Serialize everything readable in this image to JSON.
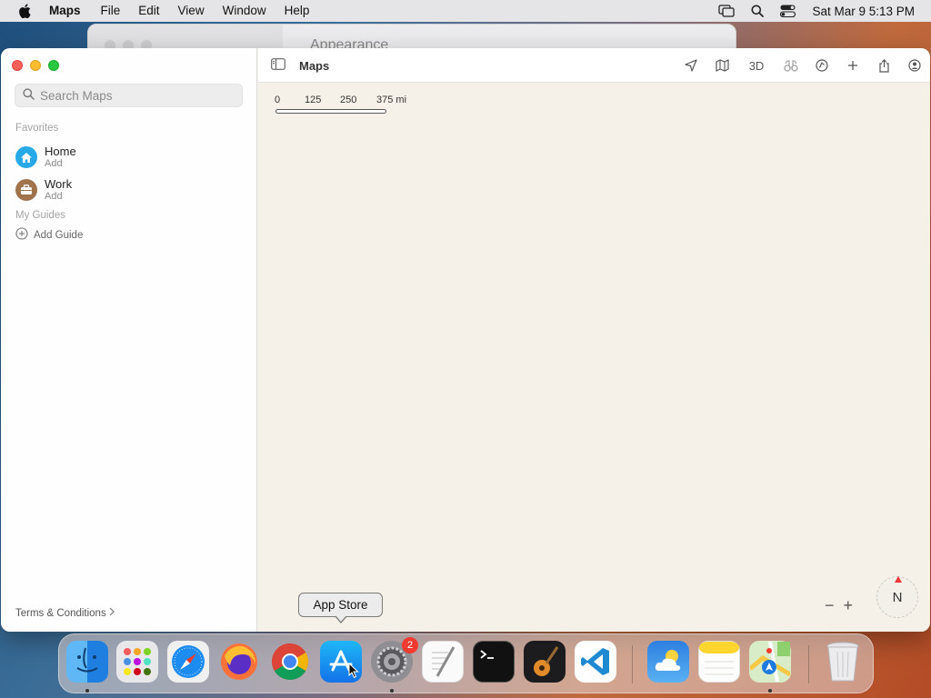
{
  "menubar": {
    "app_name": "Maps",
    "items": [
      "File",
      "Edit",
      "View",
      "Window",
      "Help"
    ],
    "datetime": "Sat Mar 9  5:13 PM"
  },
  "background_window": {
    "title": "Appearance"
  },
  "window": {
    "title": "Maps",
    "search": {
      "placeholder": "Search Maps",
      "value": ""
    },
    "favorites": {
      "label": "Favorites",
      "items": [
        {
          "name": "Home",
          "sub": "Add",
          "icon": "house-icon",
          "color": "#27a9e8"
        },
        {
          "name": "Work",
          "sub": "Add",
          "icon": "briefcase-icon",
          "color": "#a0734d"
        }
      ]
    },
    "guides": {
      "label": "My Guides",
      "add_label": "Add Guide"
    },
    "terms": "Terms & Conditions",
    "toolbar": {
      "tools": [
        "location-arrow-icon",
        "map-icon",
        "3D",
        "binoculars-icon",
        "tracking-icon",
        "plus-icon",
        "share-icon",
        "account-icon"
      ]
    },
    "map": {
      "scale": {
        "labels": [
          "0",
          "125",
          "250",
          "375 mi"
        ]
      },
      "zoom_out": "−",
      "zoom_in": "+",
      "compass": "N"
    }
  },
  "tooltip": "App Store",
  "dock": {
    "apps": [
      {
        "name": "Finder",
        "running": true
      },
      {
        "name": "Launchpad",
        "running": false
      },
      {
        "name": "Safari",
        "running": false
      },
      {
        "name": "Firefox",
        "running": false
      },
      {
        "name": "Chrome",
        "running": false
      },
      {
        "name": "App Store",
        "running": false
      },
      {
        "name": "System Preferences",
        "running": true,
        "badge": "2"
      },
      {
        "name": "TextEdit",
        "running": false
      },
      {
        "name": "Terminal",
        "running": false
      },
      {
        "name": "GarageBand",
        "running": false
      },
      {
        "name": "Visual Studio Code",
        "running": false
      },
      {
        "name": "Weather",
        "running": false
      },
      {
        "name": "Notes",
        "running": false
      },
      {
        "name": "Maps",
        "running": true
      },
      {
        "name": "Trash",
        "running": false
      }
    ]
  },
  "colors": {
    "close": "#fe5f57",
    "minimize": "#febc2e",
    "maximize": "#28c840",
    "map_background": "#f6f1e8",
    "badge": "#f23a30"
  }
}
